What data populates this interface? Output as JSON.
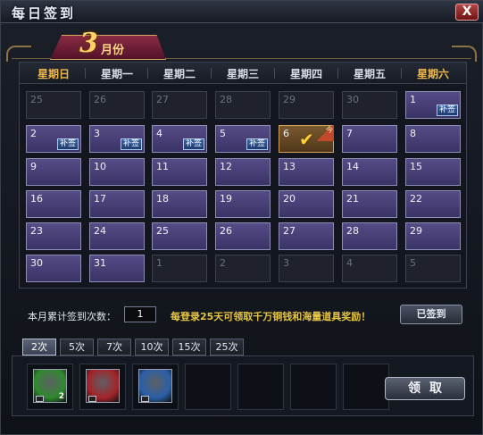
{
  "window": {
    "title": "每日签到",
    "close_label": "X"
  },
  "month": {
    "number": "3",
    "label": "月份"
  },
  "weekdays": [
    "星期日",
    "星期一",
    "星期二",
    "星期三",
    "星期四",
    "星期五",
    "星期六"
  ],
  "calendar": [
    [
      {
        "day": "25",
        "state": "other"
      },
      {
        "day": "26",
        "state": "other"
      },
      {
        "day": "27",
        "state": "other"
      },
      {
        "day": "28",
        "state": "other"
      },
      {
        "day": "29",
        "state": "other"
      },
      {
        "day": "30",
        "state": "other"
      },
      {
        "day": "1",
        "state": "makeup"
      }
    ],
    [
      {
        "day": "2",
        "state": "makeup"
      },
      {
        "day": "3",
        "state": "makeup"
      },
      {
        "day": "4",
        "state": "makeup"
      },
      {
        "day": "5",
        "state": "makeup"
      },
      {
        "day": "6",
        "state": "today"
      },
      {
        "day": "7",
        "state": "normal"
      },
      {
        "day": "8",
        "state": "normal"
      }
    ],
    [
      {
        "day": "9",
        "state": "normal"
      },
      {
        "day": "10",
        "state": "normal"
      },
      {
        "day": "11",
        "state": "normal"
      },
      {
        "day": "12",
        "state": "normal"
      },
      {
        "day": "13",
        "state": "normal"
      },
      {
        "day": "14",
        "state": "normal"
      },
      {
        "day": "15",
        "state": "normal"
      }
    ],
    [
      {
        "day": "16",
        "state": "normal"
      },
      {
        "day": "17",
        "state": "normal"
      },
      {
        "day": "18",
        "state": "normal"
      },
      {
        "day": "19",
        "state": "normal"
      },
      {
        "day": "20",
        "state": "normal"
      },
      {
        "day": "21",
        "state": "normal"
      },
      {
        "day": "22",
        "state": "normal"
      }
    ],
    [
      {
        "day": "23",
        "state": "normal"
      },
      {
        "day": "24",
        "state": "normal"
      },
      {
        "day": "25",
        "state": "normal"
      },
      {
        "day": "26",
        "state": "normal"
      },
      {
        "day": "27",
        "state": "normal"
      },
      {
        "day": "28",
        "state": "normal"
      },
      {
        "day": "29",
        "state": "normal"
      }
    ],
    [
      {
        "day": "30",
        "state": "normal"
      },
      {
        "day": "31",
        "state": "normal"
      },
      {
        "day": "1",
        "state": "other"
      },
      {
        "day": "2",
        "state": "other"
      },
      {
        "day": "3",
        "state": "other"
      },
      {
        "day": "4",
        "state": "other"
      },
      {
        "day": "5",
        "state": "other"
      }
    ]
  ],
  "makeup_label": "补签",
  "today_tag": "今",
  "counter": {
    "label": "本月累计签到次数：",
    "value": "1"
  },
  "hint": "每登录25天可领取千万铜钱和海量道具奖励！",
  "signed_button": "已签到",
  "tabs": [
    "2次",
    "5次",
    "7次",
    "10次",
    "15次",
    "25次"
  ],
  "active_tab_index": 0,
  "rewards": [
    {
      "icon": "green-crystal-icon",
      "color": "#2f8a2f",
      "quantity": "2"
    },
    {
      "icon": "red-gem-icon",
      "color": "#a3242a",
      "quantity": ""
    },
    {
      "icon": "blue-potion-icon",
      "color": "#2a5fa8",
      "quantity": ""
    }
  ],
  "claim_button": "领取"
}
